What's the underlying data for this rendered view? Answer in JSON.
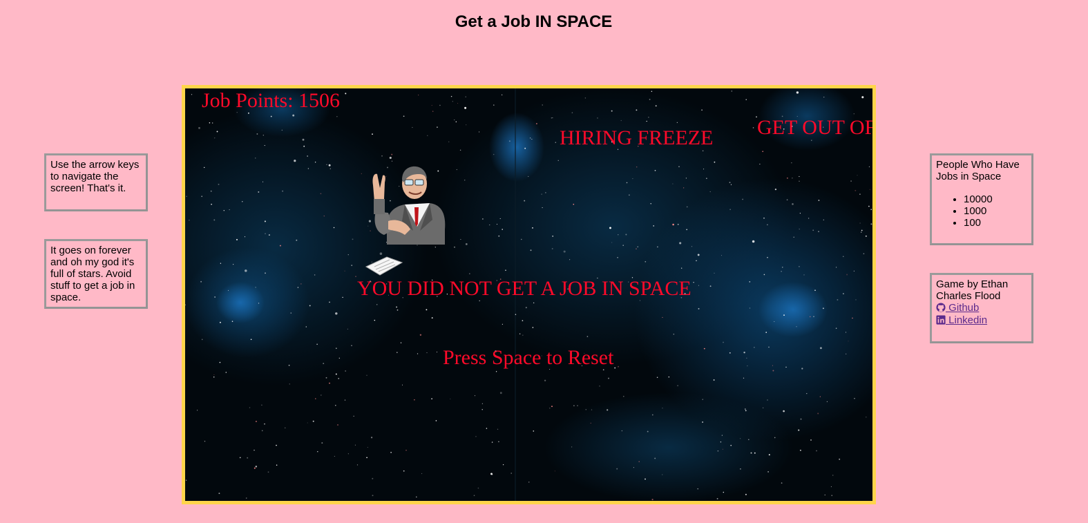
{
  "header": {
    "title": "Get a Job IN SPACE"
  },
  "left_panel": {
    "instructions": "Use the arrow keys to navigate the screen! That's it.",
    "description": "It goes on forever and oh my god it's full of stars. Avoid stuff to get a job in space."
  },
  "right_panel": {
    "people_title": "People Who Have Jobs in Space",
    "people_list": [
      "10000",
      "1000",
      "100"
    ],
    "credits_text": "Game by Ethan Charles Flood",
    "github_label": " Github",
    "linkedin_label": " Linkedin",
    "link_icons": [
      "github-icon",
      "linkedin-icon"
    ]
  },
  "game": {
    "score_text": "Job Points: 1506",
    "obstacles": [
      "HIRING FREEZE",
      "GET OUT OF"
    ],
    "game_over_text": "YOU DID NOT GET A JOB IN SPACE",
    "reset_text": "Press Space to Reset",
    "player_sprite": "businessman-with-resume",
    "colors": {
      "text": "#ff0a2a",
      "frame_border": "#ffd54a",
      "page_background": "#ffb9c7",
      "space_background": "#02080d"
    }
  }
}
